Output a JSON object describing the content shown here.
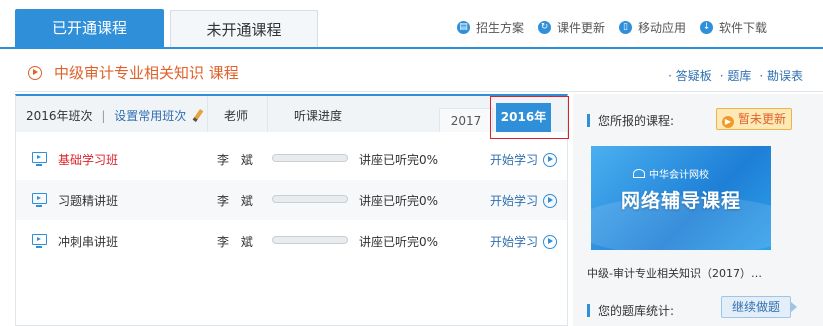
{
  "tabs": {
    "active": "已开通课程",
    "inactive": "未开通课程"
  },
  "top_links": [
    {
      "icon": "document-icon",
      "glyph": "▤",
      "label": "招生方案"
    },
    {
      "icon": "refresh-icon",
      "glyph": "↻",
      "label": "课件更新"
    },
    {
      "icon": "mobile-icon",
      "glyph": "▯",
      "label": "移动应用"
    },
    {
      "icon": "download-icon",
      "glyph": "↓",
      "label": "软件下载"
    }
  ],
  "course": {
    "title": "中级审计专业相关知识  课程"
  },
  "title_links": {
    "qa": "· 答疑板",
    "bank": "· 题库",
    "errata": "· 勘误表"
  },
  "table": {
    "year_label": "2016年班次",
    "set_common": "设置常用班次",
    "col_teacher": "老师",
    "col_progress": "听课进度",
    "years": [
      "2017",
      "2016年"
    ],
    "rows": [
      {
        "name": "基础学习班",
        "teacher": "李 斌",
        "progress": 0,
        "pct_text": "讲座已听完0%",
        "action": "开始学习"
      },
      {
        "name": "习题精讲班",
        "teacher": "李 斌",
        "progress": 0,
        "pct_text": "讲座已听完0%",
        "action": "开始学习"
      },
      {
        "name": "冲刺串讲班",
        "teacher": "李 斌",
        "progress": 0,
        "pct_text": "讲座已听完0%",
        "action": "开始学习"
      }
    ]
  },
  "sidebar": {
    "my_courses": "您所报的课程:",
    "badge": "暂未更新",
    "banner_brand": "中华会计网校",
    "banner_title": "网络辅导课程",
    "course_name": "中级-审计专业相关知识（2017）…",
    "stats": "您的题库统计:",
    "continue_btn": "继续做题"
  },
  "colors": {
    "accent": "#2f8fd8",
    "title_orange": "#e0612a",
    "highlight_red": "#d9232b"
  }
}
